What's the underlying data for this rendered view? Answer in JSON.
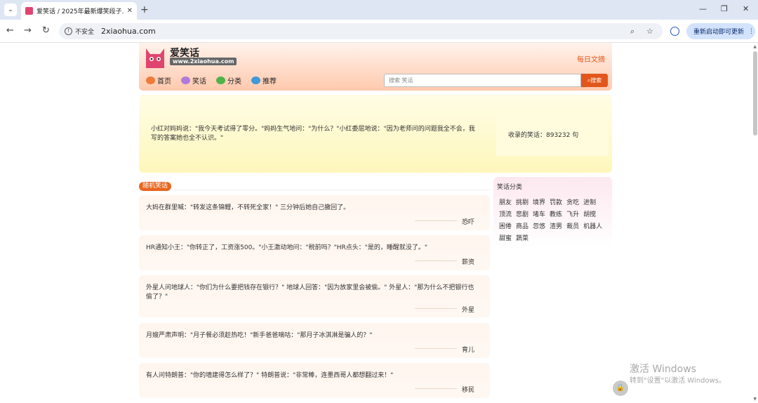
{
  "browser": {
    "tab_title": "爱笑话 / 2025年最新爆笑段子...",
    "url": "2xiaohua.com",
    "security_label": "不安全",
    "restart_label": "重新启动即可更新"
  },
  "site": {
    "logo_name": "爱笑话",
    "logo_domain": "www.2xiaohua.com",
    "daily_link": "每日文摘",
    "nav": [
      "首页",
      "笑话",
      "分类",
      "推荐"
    ],
    "search_placeholder": "搜索 笑话",
    "search_button": "搜索"
  },
  "featured": {
    "joke": "小红对妈妈说：\"我今天考试得了零分。\"妈妈生气地问：\"为什么？\"小红委屈地说：\"因为老师问的问题我全不会，我写的答案她也全不认识。\"",
    "stats": "收录的笑话：893232 句"
  },
  "random_section": {
    "label": "随机笑话"
  },
  "jokes": [
    {
      "text": "大妈在群里喊：\"转发这条锦鲤，不转死全家！\" 三分钟后她自己撤回了。",
      "category": "恐吓"
    },
    {
      "text": "HR通知小王：\"你转正了，工资涨500。\"小王激动地问：\"税前吗？\"HR点头：\"是的，睡醒就没了。\"",
      "category": "薪资"
    },
    {
      "text": "外星人问地球人：\"你们为什么要把钱存在银行？\" 地球人回答：\"因为放家里会被偷。\" 外星人：\"那为什么不把银行也偷了？\"",
      "category": "外星"
    },
    {
      "text": "月嫂严肃声明：\"月子餐必须趁热吃！\"新手爸爸嘀咕：\"那月子冰淇淋是骗人的？\"",
      "category": "育儿"
    },
    {
      "text": "有人问特朗普：\"你的墙建得怎么样了？\" 特朗普说：\"非常棒，连墨西哥人都想翻过来！\"",
      "category": "移民"
    }
  ],
  "categories": {
    "title": "笑话分类",
    "items": [
      "朋友",
      "挑剔",
      "境界",
      "罚款",
      "贪吃",
      "进制",
      "顶流",
      "悲剧",
      "堵车",
      "教练",
      "飞升",
      "胡搅",
      "困倦",
      "商品",
      "忽悠",
      "渣男",
      "裁员",
      "机器人",
      "甜蜜",
      "蔬菜"
    ]
  },
  "watermark": {
    "line1": "激活 Windows",
    "line2": "转到\"设置\"以激活 Windows。"
  },
  "colors": {
    "accent": "#e2561b",
    "header_bg": "#ffc9ad",
    "featured_bg": "#fef7bb"
  }
}
